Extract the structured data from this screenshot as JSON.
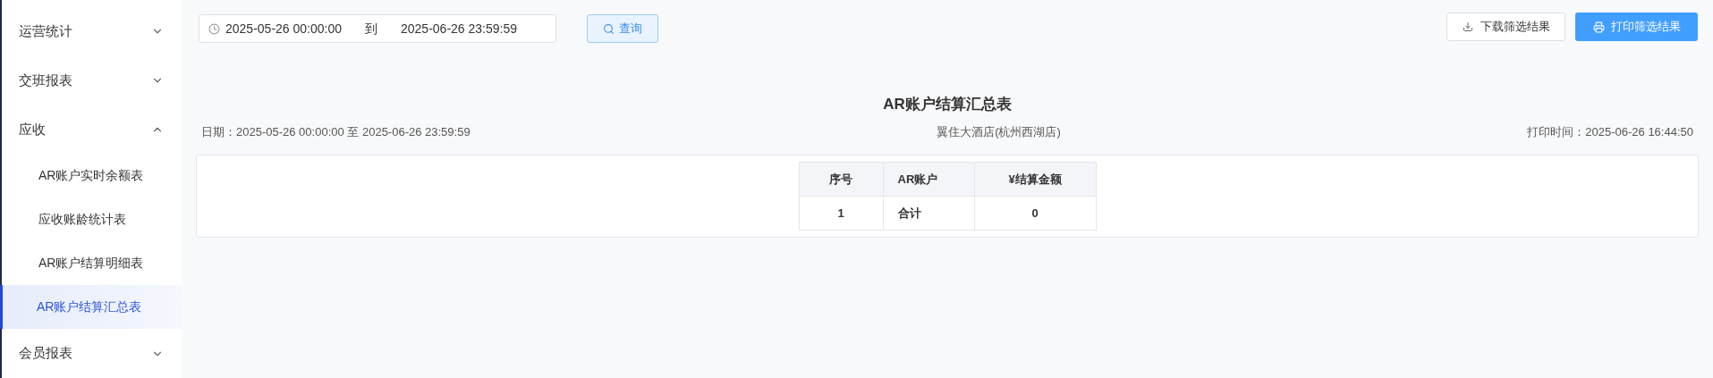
{
  "sidebar": {
    "items": [
      {
        "label": "运营统计",
        "expanded": false
      },
      {
        "label": "交班报表",
        "expanded": false
      },
      {
        "label": "应收",
        "expanded": true,
        "children": [
          {
            "label": "AR账户实时余额表",
            "selected": false
          },
          {
            "label": "应收账龄统计表",
            "selected": false
          },
          {
            "label": "AR账户结算明细表",
            "selected": false
          },
          {
            "label": "AR账户结算汇总表",
            "selected": true
          }
        ]
      },
      {
        "label": "会员报表",
        "expanded": false
      }
    ]
  },
  "filter": {
    "start": "2025-05-26 00:00:00",
    "separator": "到",
    "end": "2025-06-26 23:59:59",
    "query_button": "查询"
  },
  "actions": {
    "download": "下载筛选结果",
    "print": "打印筛选结果"
  },
  "report": {
    "title": "AR账户结算汇总表",
    "date_range": "日期：2025-05-26 00:00:00 至 2025-06-26 23:59:59",
    "hotel": "翼住大酒店(杭州西湖店)",
    "print_time": "打印时间：2025-06-26 16:44:50"
  },
  "table": {
    "columns": [
      "序号",
      "AR账户",
      "¥结算金额"
    ],
    "rows": [
      [
        "1",
        "合计",
        "0"
      ]
    ]
  }
}
